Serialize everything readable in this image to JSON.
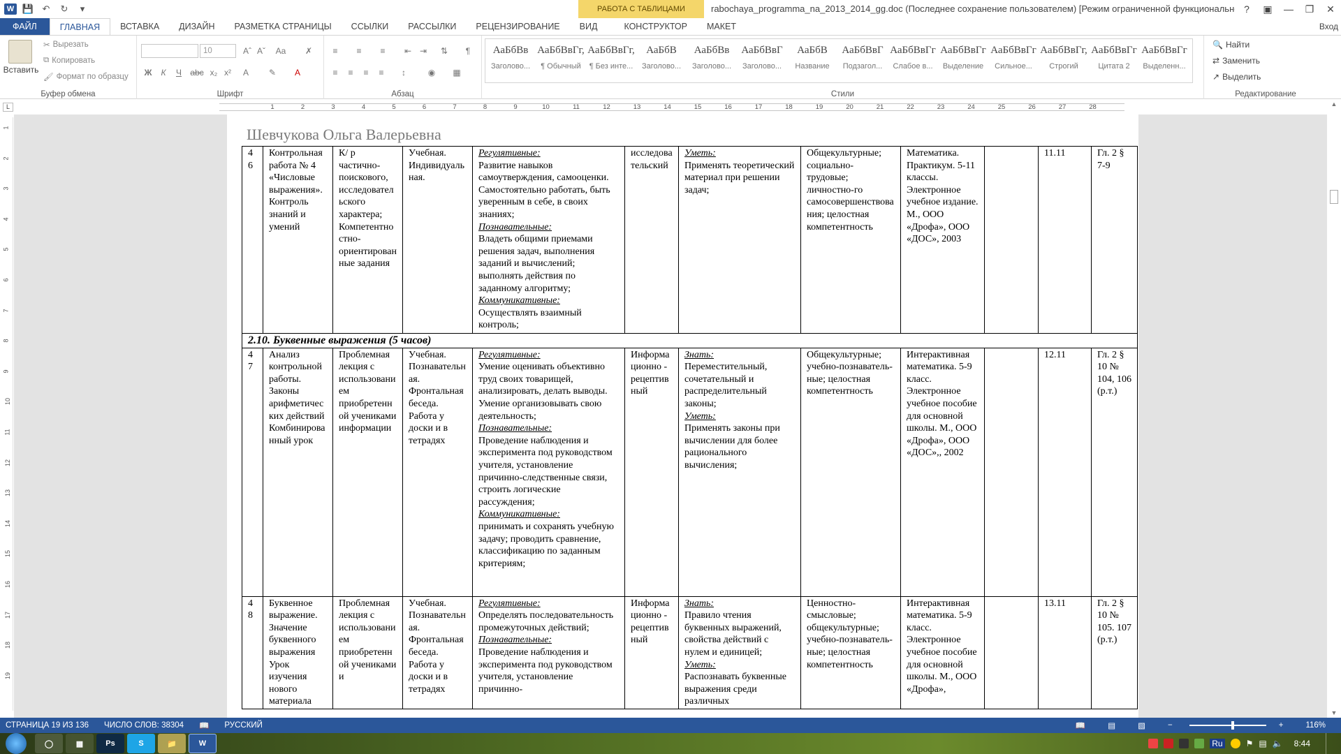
{
  "titlebar": {
    "app_logo": "W",
    "context_header": "РАБОТА С ТАБЛИЦАМИ",
    "document_title": "rabochaya_programma_na_2013_2014_gg.doc (Последнее сохранение пользователем) [Режим ограниченной функциональности] - Wo...",
    "icons": [
      "save-icon",
      "undo-icon",
      "redo-icon",
      "customize-icon",
      "help-icon",
      "ribbon-display-icon",
      "minimize-icon",
      "restore-icon",
      "close-icon"
    ]
  },
  "tabs": {
    "file": "ФАЙЛ",
    "items": [
      "ГЛАВНАЯ",
      "ВСТАВКА",
      "ДИЗАЙН",
      "РАЗМЕТКА СТРАНИЦЫ",
      "ССЫЛКИ",
      "РАССЫЛКИ",
      "РЕЦЕНЗИРОВАНИЕ",
      "ВИД"
    ],
    "context_items": [
      "КОНСТРУКТОР",
      "МАКЕТ"
    ],
    "active": "ГЛАВНАЯ",
    "signin": "Вход"
  },
  "ribbon": {
    "clipboard": {
      "label": "Буфер обмена",
      "paste": "Вставить",
      "cut": "Вырезать",
      "copy": "Копировать",
      "format_painter": "Формат по образцу"
    },
    "font": {
      "label": "Шрифт",
      "font_name": "",
      "font_size": "10"
    },
    "paragraph": {
      "label": "Абзац"
    },
    "styles": {
      "label": "Стили",
      "items": [
        {
          "sample": "АаБбВв",
          "name": "Заголово..."
        },
        {
          "sample": "АаБбВвГг,",
          "name": "¶ Обычный"
        },
        {
          "sample": "АаБбВвГг,",
          "name": "¶ Без инте..."
        },
        {
          "sample": "АаБбВ",
          "name": "Заголово..."
        },
        {
          "sample": "АаБбВв",
          "name": "Заголово..."
        },
        {
          "sample": "АаБбВвГ",
          "name": "Заголово..."
        },
        {
          "sample": "АаБбВ",
          "name": "Название"
        },
        {
          "sample": "АаБбВвГ",
          "name": "Подзагол..."
        },
        {
          "sample": "АаБбВвГг",
          "name": "Слабое в..."
        },
        {
          "sample": "АаБбВвГг",
          "name": "Выделение"
        },
        {
          "sample": "АаБбВвГг",
          "name": "Сильное..."
        },
        {
          "sample": "АаБбВвГг,",
          "name": "Строгий"
        },
        {
          "sample": "АаБбВвГг",
          "name": "Цитата 2"
        },
        {
          "sample": "АаБбВвГг",
          "name": "Выделенн..."
        }
      ]
    },
    "editing": {
      "label": "Редактирование",
      "find": "Найти",
      "replace": "Заменить",
      "select": "Выделить"
    }
  },
  "ruler": {
    "corner": "L",
    "h_numbers": [
      "1",
      "2",
      "3",
      "4",
      "5",
      "6",
      "7",
      "8",
      "9",
      "10",
      "11",
      "12",
      "13",
      "14",
      "15",
      "16",
      "17",
      "18",
      "19",
      "20",
      "21",
      "22",
      "23",
      "24",
      "25",
      "26",
      "27",
      "28"
    ],
    "v_numbers": [
      "1",
      "2",
      "3",
      "4",
      "5",
      "6",
      "7",
      "8",
      "9",
      "10",
      "11",
      "12",
      "13",
      "14",
      "15",
      "16",
      "17",
      "18",
      "19"
    ]
  },
  "document": {
    "header_name": "Шевчукова Ольга Валерьевна",
    "rows": [
      {
        "num": "4 6",
        "topic": "Контрольная работа № 4 «Числовые выражения». Контроль знаний и умений",
        "type": "К/ р частично-поискового, исследовательского характера; Компетентностно-ориентированные задания",
        "form": "Учебная. Индивидуальная.",
        "uud": [
          {
            "head": "Регулятивные:",
            "text": "Развитие навыков самоутверждения, самооценки. Самостоятельно работать, быть уверенным в себе, в своих знаниях;"
          },
          {
            "head": "Познавательные:",
            "text": "Владеть общими приемами решения задач, выполнения заданий и вычислений; выполнять действия по заданному алгоритму;"
          },
          {
            "head": "Коммуникативные:",
            "text": "Осуществлять взаимный контроль;"
          }
        ],
        "activity": "исследовательский",
        "skills": [
          {
            "head": "Уметь:",
            "text": "Применять теоретический материал при решении задач;"
          }
        ],
        "competence": "Общекультурные; социально-трудовые; личностно-го самосовершенствования; целостная компетентность",
        "resources": "Математика. Практикум. 5-11 классы. Электронное учебное издание. М., ООО «Дрофа», ООО «ДОС», 2003",
        "empty": "",
        "date": "11.11",
        "homework": "Гл. 2 § 7-9"
      },
      {
        "num": "4 7",
        "topic": "Анализ контрольной работы. Законы арифметических действий Комбинированный урок",
        "type": "Проблемная лекция с использованием приобретенной учениками информации",
        "form": "Учебная. Познавательная. Фронтальная беседа. Работа у доски и в тетрадях",
        "uud": [
          {
            "head": "Регулятивные:",
            "text": "Умение оценивать объективно труд своих товарищей, анализировать, делать выводы. Умение организовывать свою деятельность;"
          },
          {
            "head": "Познавательные:",
            "text": "Проведение наблюдения и эксперимента под руководством учителя, установление причинно-следственные связи, строить логические рассуждения;"
          },
          {
            "head": "Коммуникативные:",
            "text": "принимать и сохранять учебную задачу; проводить сравнение, классификацию по заданным критериям;"
          }
        ],
        "activity": "Информационно - рецептивный",
        "skills": [
          {
            "head": "Знать:",
            "text": "Переместительный, сочетательный и распределительный законы;"
          },
          {
            "head": "Уметь:",
            "text": "Применять законы при вычислении для более рационального вычисления;"
          }
        ],
        "competence": "Общекультурные; учебно-познаватель-ные; целостная компетентность",
        "resources": "Интерактивная математика. 5-9 класс. Электронное учебное пособие для основной школы. М., ООО «Дрофа», ООО «ДОС»,, 2002",
        "empty": "",
        "date": "12.11",
        "homework": "Гл. 2 § 10 № 104, 106 (р.т.)"
      },
      {
        "num": "4 8",
        "topic": "Буквенное выражение. Значение буквенного выражения Урок изучения нового материала",
        "type": "Проблемная лекция с использованием приобретенной учениками и",
        "form": "Учебная. Познавательная. Фронтальная беседа. Работа у доски и в тетрадях",
        "uud": [
          {
            "head": "Регулятивные:",
            "text": "Определять последовательность промежуточных действий;"
          },
          {
            "head": "Познавательные:",
            "text": "Проведение наблюдения и эксперимента под руководством учителя, установление причинно-"
          }
        ],
        "activity": "Информационно - рецептивный",
        "skills": [
          {
            "head": "Знать:",
            "text": "Правило чтения буквенных выражений, свойства действий с нулем и единицей;"
          },
          {
            "head": "Уметь:",
            "text": "Распознавать буквенные выражения среди различных"
          }
        ],
        "competence": "Ценностно-смысловые; общекультурные; учебно-познаватель-ные; целостная компетентность",
        "resources": "Интерактивная математика. 5-9 класс. Электронное учебное пособие для основной школы. М., ООО «Дрофа»,",
        "empty": "",
        "date": "13.11",
        "homework": "Гл. 2 § 10 № 105. 107 (р.т.)"
      }
    ],
    "section_title": "2.10. Буквенные выражения (5 часов)"
  },
  "statusbar": {
    "page": "СТРАНИЦА 19 ИЗ 136",
    "words": "ЧИСЛО СЛОВ: 38304",
    "language": "РУССКИЙ",
    "zoom": "116%"
  },
  "taskbar": {
    "apps": [
      "chrome",
      "calc",
      "Ps",
      "S",
      "explorer",
      "W"
    ],
    "tray_lang": "Ru",
    "clock": "8:44"
  },
  "colors": {
    "accent": "#2b579a",
    "context_tab": "#f4d66a"
  }
}
